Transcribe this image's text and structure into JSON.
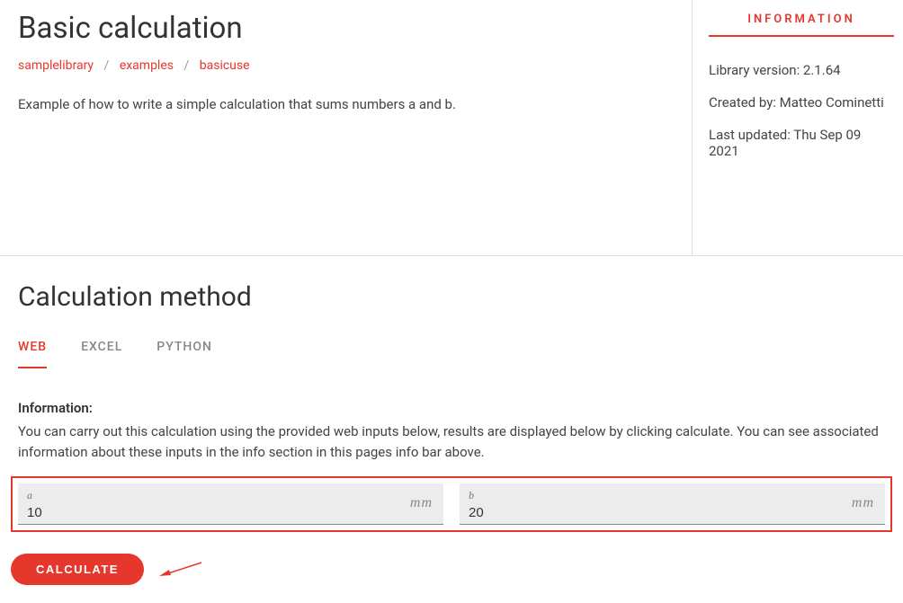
{
  "header": {
    "title": "Basic calculation",
    "breadcrumb": [
      "samplelibrary",
      "examples",
      "basicuse"
    ],
    "description": "Example of how to write a simple calculation that sums numbers a and b."
  },
  "info_panel": {
    "heading": "INFORMATION",
    "version_label": "Library version: 2.1.64",
    "created_by": "Created by: Matteo Cominetti",
    "last_updated": "Last updated: Thu Sep 09 2021"
  },
  "method": {
    "title": "Calculation method",
    "tabs": [
      "WEB",
      "EXCEL",
      "PYTHON"
    ],
    "active_tab": 0,
    "subhead": "Information:",
    "subdesc": "You can carry out this calculation using the provided web inputs below, results are displayed below by clicking calculate. You can see associated information about these inputs in the info section in this pages info bar above.",
    "inputs": {
      "a": {
        "label": "a",
        "value": "10",
        "unit": "mm"
      },
      "b": {
        "label": "b",
        "value": "20",
        "unit": "mm"
      }
    },
    "calculate_label": "CALCULATE"
  }
}
